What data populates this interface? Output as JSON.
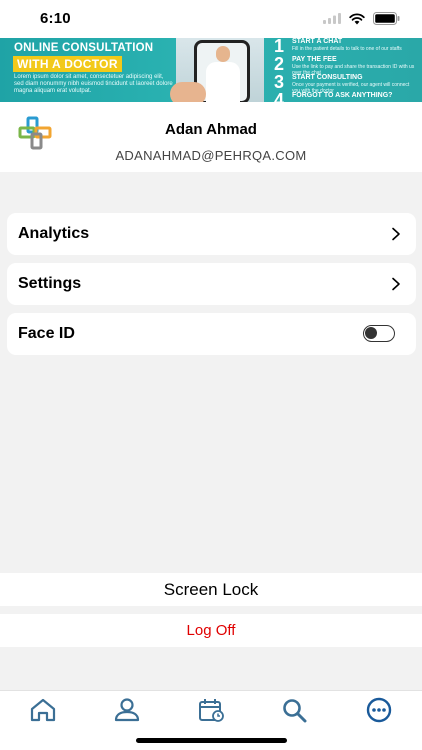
{
  "status_bar": {
    "time": "6:10",
    "icons": [
      "signal-icon",
      "wifi-icon",
      "battery-icon"
    ]
  },
  "banner": {
    "title": "ONLINE CONSULTATION",
    "highlight": "WITH A DOCTOR",
    "body": "Lorem ipsum dolor sit amet, consectetuer adipiscing elit, sed diam nonummy nibh euismod tincidunt ut laoreet dolore magna aliquam erat volutpat.",
    "steps": [
      {
        "num": "1",
        "title": "START A CHAT",
        "text": "Fill in the patient details to talk to one of our staffs"
      },
      {
        "num": "2",
        "title": "PAY THE FEE",
        "text": "Use the link to pay and share the transaction ID with us over the chat"
      },
      {
        "num": "3",
        "title": "START CONSULTING",
        "text": "Once your payment is verified, our agent will connect you with the doctor"
      },
      {
        "num": "4",
        "title": "FORGOT TO ASK ANYTHING?",
        "text": ""
      }
    ]
  },
  "profile": {
    "name": "Adan Ahmad",
    "email": "ADANAHMAD@PEHRQA.COM"
  },
  "menu": {
    "analytics_label": "Analytics",
    "settings_label": "Settings",
    "face_id_label": "Face ID",
    "face_id_enabled": false
  },
  "actions": {
    "screen_lock_label": "Screen Lock",
    "log_off_label": "Log Off"
  },
  "tab_bar": {
    "tabs": [
      "home-icon",
      "profile-icon",
      "appointments-icon",
      "search-icon",
      "more-icon"
    ],
    "active_tab": "more-icon"
  },
  "colors": {
    "accent": "#1a5a9a",
    "banner_teal": "#2bb3b2",
    "banner_yellow": "#f2c919",
    "logoff_red": "#e00000",
    "tab_icon": "#3b6f95"
  }
}
